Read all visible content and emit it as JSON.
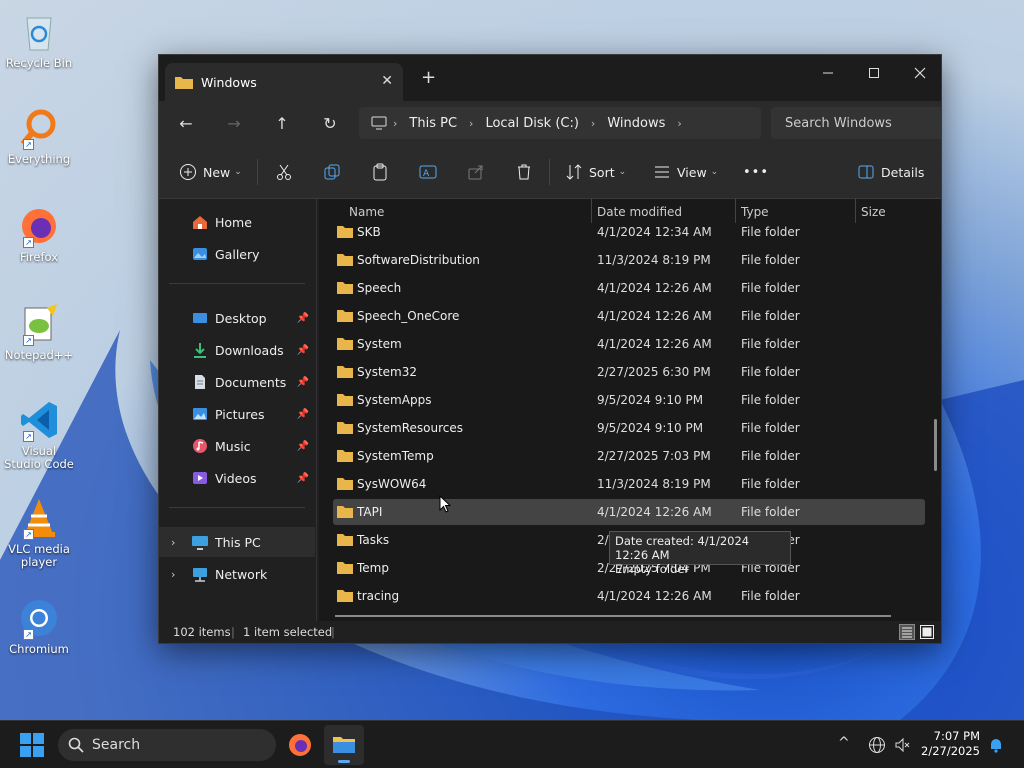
{
  "desktop": {
    "icons": [
      {
        "label": "Recycle Bin",
        "icon": "recycle-bin-icon"
      },
      {
        "label": "Everything",
        "icon": "everything-icon"
      },
      {
        "label": "Firefox",
        "icon": "firefox-icon"
      },
      {
        "label": "Notepad++",
        "icon": "notepadpp-icon"
      },
      {
        "label": "Visual Studio Code",
        "icon": "vscode-icon"
      },
      {
        "label": "VLC media player",
        "icon": "vlc-icon"
      },
      {
        "label": "Chromium",
        "icon": "chromium-icon"
      }
    ]
  },
  "window": {
    "tab_title": "Windows",
    "breadcrumb": [
      "This PC",
      "Local Disk (C:)",
      "Windows"
    ],
    "search_placeholder": "Search Windows",
    "commands": {
      "new": "New",
      "sort": "Sort",
      "view": "View",
      "more": "•••",
      "details": "Details"
    },
    "columns": {
      "name": "Name",
      "date": "Date modified",
      "type": "Type",
      "size": "Size"
    },
    "nav": {
      "home": "Home",
      "gallery": "Gallery",
      "desktop": "Desktop",
      "downloads": "Downloads",
      "documents": "Documents",
      "pictures": "Pictures",
      "music": "Music",
      "videos": "Videos",
      "this_pc": "This PC",
      "network": "Network"
    },
    "files": [
      {
        "name": "SKB",
        "date": "4/1/2024 12:34 AM",
        "type": "File folder"
      },
      {
        "name": "SoftwareDistribution",
        "date": "11/3/2024 8:19 PM",
        "type": "File folder"
      },
      {
        "name": "Speech",
        "date": "4/1/2024 12:26 AM",
        "type": "File folder"
      },
      {
        "name": "Speech_OneCore",
        "date": "4/1/2024 12:26 AM",
        "type": "File folder"
      },
      {
        "name": "System",
        "date": "4/1/2024 12:26 AM",
        "type": "File folder"
      },
      {
        "name": "System32",
        "date": "2/27/2025 6:30 PM",
        "type": "File folder"
      },
      {
        "name": "SystemApps",
        "date": "9/5/2024 9:10 PM",
        "type": "File folder"
      },
      {
        "name": "SystemResources",
        "date": "9/5/2024 9:10 PM",
        "type": "File folder"
      },
      {
        "name": "SystemTemp",
        "date": "2/27/2025 7:03 PM",
        "type": "File folder"
      },
      {
        "name": "SysWOW64",
        "date": "11/3/2024 8:19 PM",
        "type": "File folder"
      },
      {
        "name": "TAPI",
        "date": "4/1/2024 12:26 AM",
        "type": "File folder"
      },
      {
        "name": "Tasks",
        "date": "2/27/2024 8:14 PM",
        "type": "File folder"
      },
      {
        "name": "Temp",
        "date": "2/27/2025 7:04 PM",
        "type": "File folder"
      },
      {
        "name": "tracing",
        "date": "4/1/2024 12:26 AM",
        "type": "File folder"
      }
    ],
    "tooltip": {
      "line1": "Date created: 4/1/2024 12:26 AM",
      "line2": "Empty folder"
    },
    "status": {
      "items": "102 items",
      "selected": "1 item selected"
    }
  },
  "taskbar": {
    "search_label": "Search",
    "time": "7:07 PM",
    "date": "2/27/2025"
  },
  "colors": {
    "accent": "#0078d4",
    "folder": "#e8b64a",
    "window_bg": "#202020"
  }
}
